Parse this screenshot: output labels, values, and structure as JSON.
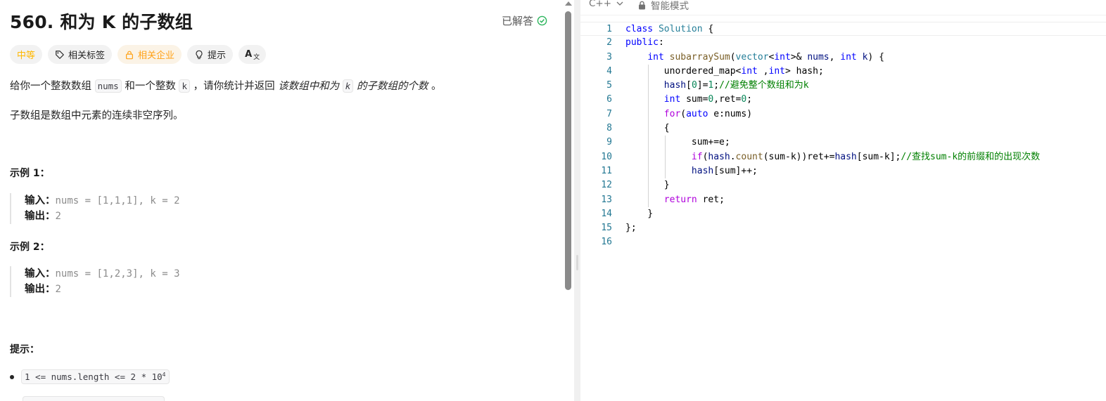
{
  "problem": {
    "title": "560. 和为 K 的子数组",
    "status": "已解答",
    "tags": {
      "difficulty": "中等",
      "related_tags": "相关标签",
      "related_companies": "相关企业",
      "hint": "提示",
      "translate": "A"
    },
    "description": {
      "p1_a": "给你一个整数数组",
      "p1_nums": "nums",
      "p1_b": "和一个整数",
      "p1_k": "k",
      "p1_c": "，请你统计并返回",
      "p1_em1": "该数组中和为",
      "p1_k2": "k",
      "p1_em2": "的子数组的个数",
      "p1_end": "。",
      "p2": "子数组是数组中元素的连续非空序列。"
    },
    "examples": [
      {
        "heading": "示例 1：",
        "input_label": "输入：",
        "input": "nums = [1,1,1], k = 2",
        "output_label": "输出：",
        "output": "2"
      },
      {
        "heading": "示例 2：",
        "input_label": "输入：",
        "input": "nums = [1,2,3], k = 3",
        "output_label": "输出：",
        "output": "2"
      }
    ],
    "hints_heading": "提示：",
    "constraint_1": "1 <= nums.length <= 2 * 10",
    "constraint_1_exp": "4"
  },
  "editor": {
    "language": "C++",
    "mode": "智能模式",
    "line_numbers": [
      "1",
      "2",
      "3",
      "4",
      "5",
      "6",
      "7",
      "8",
      "9",
      "10",
      "11",
      "12",
      "13",
      "14",
      "15",
      "16"
    ]
  },
  "colors": {
    "difficulty": "#ffb800",
    "solved_check": "#2db55d",
    "keyword": "#0000ff",
    "type": "#267f99",
    "function": "#795e26",
    "control": "#af00db",
    "number": "#098658",
    "comment": "#008000"
  }
}
